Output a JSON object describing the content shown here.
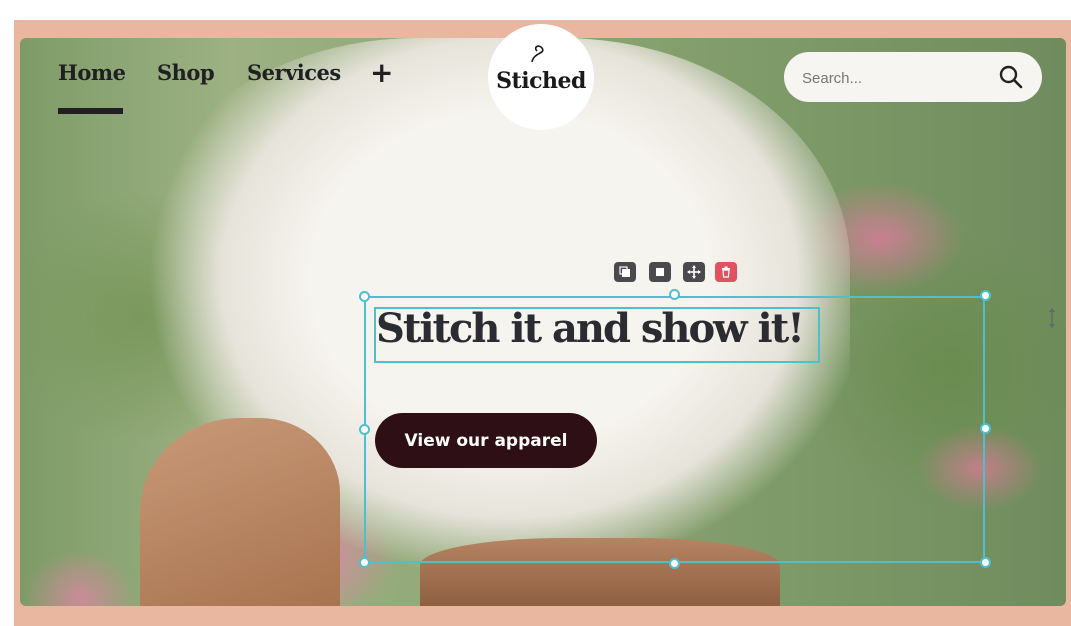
{
  "nav": {
    "items": [
      {
        "label": "Home",
        "active": true
      },
      {
        "label": "Shop",
        "active": false
      },
      {
        "label": "Services",
        "active": false
      }
    ],
    "add_icon": "plus-icon"
  },
  "logo": {
    "text": "Stiched"
  },
  "search": {
    "placeholder": "Search...",
    "icon": "search-icon"
  },
  "editor_toolbar": {
    "icons": [
      "duplicate-icon",
      "copy-icon",
      "move-icon",
      "trash-icon"
    ]
  },
  "hero": {
    "headline": "Stitch it and show it!",
    "cta_label": "View our apparel"
  },
  "colors": {
    "frame": "#e9b7a0",
    "cta_bg": "#2e0f16",
    "selection": "#4fbfcf",
    "delete": "#e0525f"
  }
}
